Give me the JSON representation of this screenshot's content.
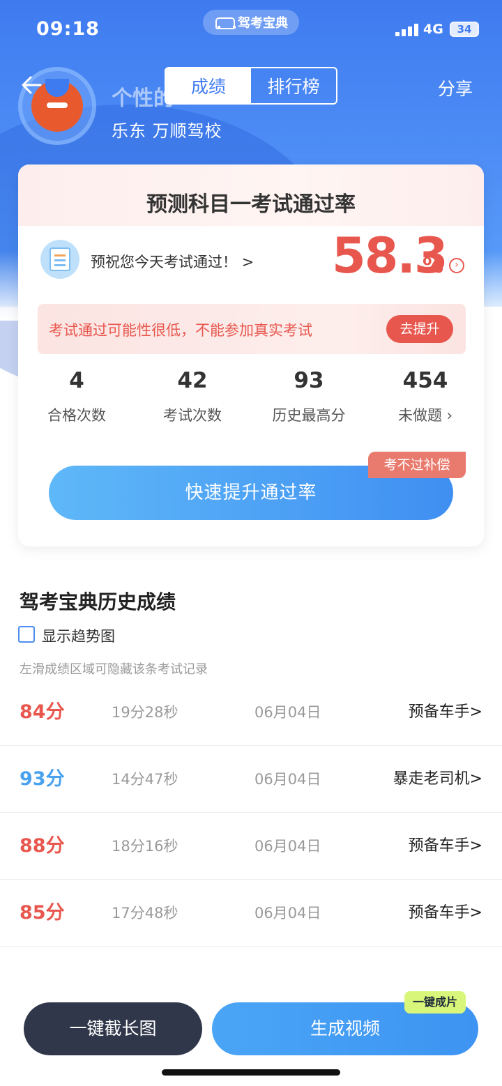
{
  "status": {
    "time": "09:18",
    "network": "4G",
    "battery": "34"
  },
  "app_pill": {
    "name": "驾考宝典",
    "icon": "car-icon"
  },
  "nav": {
    "tabs": [
      "成绩",
      "排行榜"
    ],
    "active_tab": 0,
    "share": "分享"
  },
  "profile": {
    "nickname": "个性的",
    "school": "乐东  万顺驾校"
  },
  "prediction": {
    "title": "预测科目一考试通过率",
    "wish": "预祝您今天考试通过！ >",
    "rate": "58.3",
    "rate_unit": "%",
    "warning": "考试通过可能性很低，不能参加真实考试",
    "improve_button": "去提升",
    "stats": [
      {
        "value": "4",
        "label": "合格次数"
      },
      {
        "value": "42",
        "label": "考试次数"
      },
      {
        "value": "93",
        "label": "历史最高分"
      },
      {
        "value": "454",
        "label": "未做题 ›"
      }
    ],
    "compensation_tag": "考不过补偿",
    "boost_button": "快速提升通过率"
  },
  "history": {
    "title": "驾考宝典历史成绩",
    "trend_label": "显示趋势图",
    "hint": "左滑成绩区域可隐藏该条考试记录",
    "rows": [
      {
        "score": "84分",
        "color": "red",
        "duration": "19分28秒",
        "date": "06月04日",
        "level": "预备车手>"
      },
      {
        "score": "93分",
        "color": "blue",
        "duration": "14分47秒",
        "date": "06月04日",
        "level": "暴走老司机>"
      },
      {
        "score": "88分",
        "color": "red",
        "duration": "18分16秒",
        "date": "06月04日",
        "level": "预备车手>"
      },
      {
        "score": "85分",
        "color": "red",
        "duration": "17分48秒",
        "date": "06月04日",
        "level": "预备车手>"
      }
    ]
  },
  "bottom": {
    "screenshot_button": "一键截长图",
    "video_button": "生成视频",
    "video_tag": "一键成片"
  },
  "colors": {
    "primary_blue": "#3f7bf0",
    "alert_red": "#e8574e",
    "score_blue": "#4aa2ee",
    "dark_button": "#30374a"
  }
}
